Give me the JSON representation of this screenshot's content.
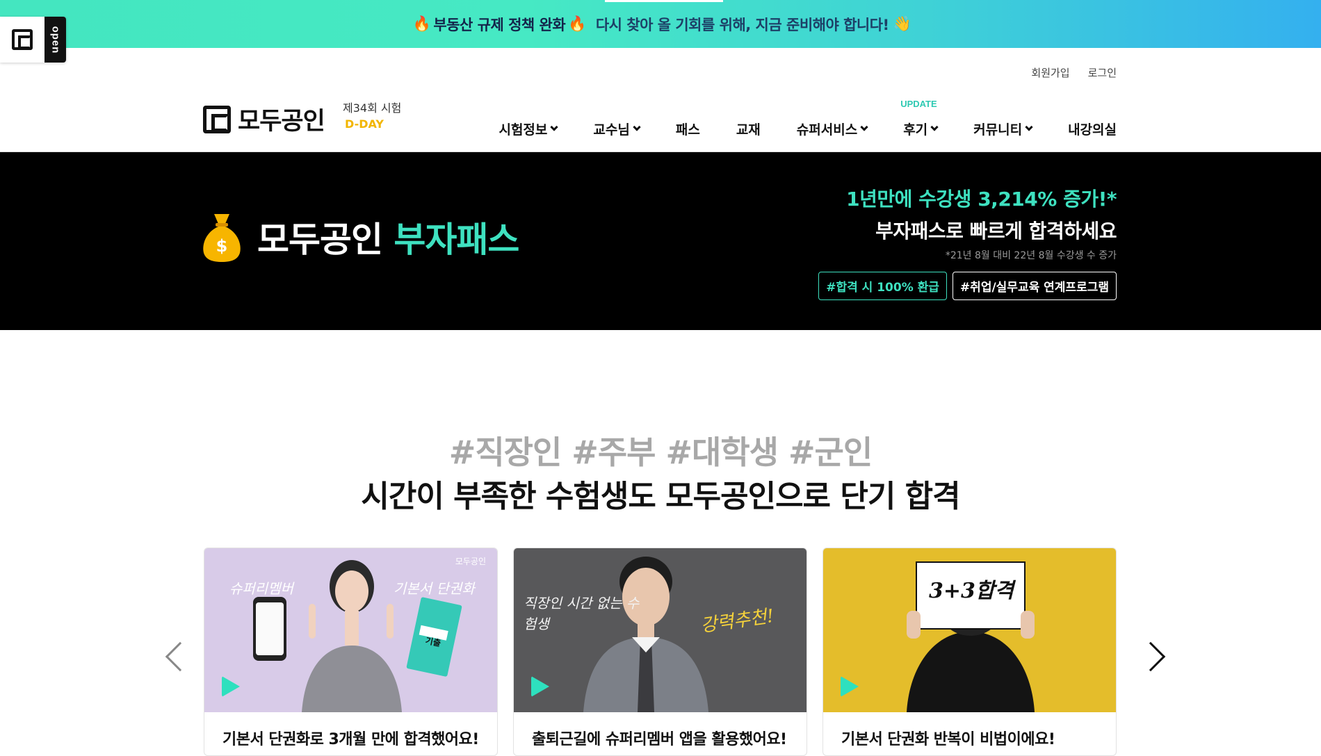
{
  "promo": {
    "fire": "🔥",
    "headline": "부동산 규제 정책 완화",
    "message": "다시 찾아 올 기회를 위해, 지금 준비해야 합니다!",
    "wave": "👋"
  },
  "open_badge": {
    "label": "open"
  },
  "util_links": {
    "signup": "회원가입",
    "login": "로그인"
  },
  "brand": {
    "name": "모두공인"
  },
  "exam": {
    "round": "제34회 시험",
    "dday": "D-DAY"
  },
  "nav": {
    "items": [
      {
        "label": "시험정보",
        "dropdown": true
      },
      {
        "label": "교수님",
        "dropdown": true
      },
      {
        "label": "패스",
        "dropdown": false
      },
      {
        "label": "교재",
        "dropdown": false
      },
      {
        "label": "슈퍼서비스",
        "dropdown": true
      },
      {
        "label": "후기",
        "dropdown": true,
        "badge": "UPDATE"
      },
      {
        "label": "커뮤니티",
        "dropdown": true
      },
      {
        "label": "내강의실",
        "dropdown": false
      }
    ]
  },
  "hero": {
    "title_main": "모두공인",
    "title_accent": "부자패스",
    "line1": "1년만에 수강생 3,214% 증가!*",
    "line2": "부자패스로 빠르게 합격하세요",
    "footnote": "*21년 8월 대비 22년 8월 수강생 수 증가",
    "tags": [
      "#합격 시 100% 환급",
      "#취업/실무교육 연계프로그램"
    ]
  },
  "section": {
    "hashtags": "#직장인 #주부 #대학생 #군인",
    "title": "시간이 부족한 수험생도 모두공인으로 단기 합격"
  },
  "cards": [
    {
      "caption": "기본서 단권화로 3개월 만에 합격했어요!",
      "overlay_left": "슈퍼리멤버",
      "overlay_right": "기본서 단권화",
      "watermark": "모두공인",
      "book_label": "기출",
      "bg": "#d8cbe8"
    },
    {
      "caption": "출퇴근길에 슈퍼리멤버 앱을 활용했어요!",
      "overlay_left": "직장인 시간 없는 수험생",
      "overlay_right": "강력추천!",
      "bg": "#58585a"
    },
    {
      "caption": "기본서 단권화 반복이 비법이에요!",
      "overlay_sign": "3+3합격",
      "bg": "#e4bd2b"
    }
  ],
  "colors": {
    "accent_green": "#3ee1c0",
    "dday_yellow": "#f2b500",
    "hero_bg": "#000000"
  }
}
